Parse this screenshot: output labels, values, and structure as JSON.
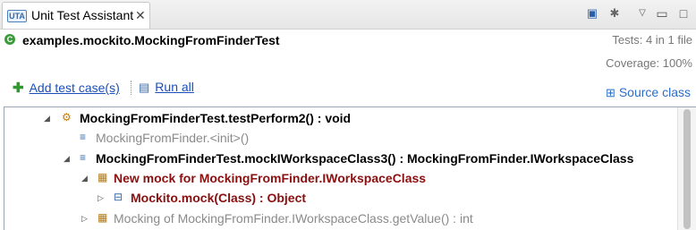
{
  "tab": {
    "icon_text": "UTA",
    "title": "Unit Test Assistant",
    "close": "✕"
  },
  "toolbar": {
    "icons": [
      "layout-icon",
      "settings-icon",
      "view-menu-icon",
      "minimize-icon",
      "maximize-icon"
    ]
  },
  "header": {
    "class_name": "examples.mockito.MockingFromFinderTest",
    "tests": "Tests: 4 in 1 file",
    "coverage": "Coverage: 100%"
  },
  "actions": {
    "add_test_case": "Add test case(s)",
    "run_all": "Run all",
    "source_class": "Source class"
  },
  "tree": {
    "rows": [
      {
        "text": "MockingFromFinderTest.testPerform2() : void",
        "expander": "◢",
        "style": "bold"
      },
      {
        "text": "MockingFromFinder.<init>()",
        "expander": "",
        "style": "gray"
      },
      {
        "text": "MockingFromFinderTest.mockIWorkspaceClass3() : MockingFromFinder.IWorkspaceClass",
        "expander": "◢",
        "style": "bold"
      },
      {
        "text": "New mock for MockingFromFinder.IWorkspaceClass",
        "expander": "◢",
        "style": "maroon"
      },
      {
        "text": "Mockito.mock(Class) : Object",
        "expander": "▷",
        "style": "maroon"
      },
      {
        "text": "Mocking of MockingFromFinder.IWorkspaceClass.getValue() : int",
        "expander": "▷",
        "style": "gray"
      }
    ]
  },
  "colors": {
    "link": "#1a4fbb",
    "mock": "#8b0f0f",
    "muted": "#8a8a8a"
  }
}
